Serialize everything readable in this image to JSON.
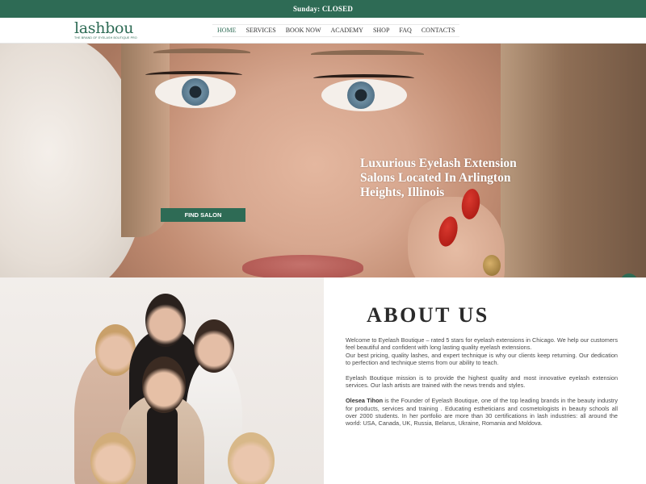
{
  "topbar": {
    "status": "Sunday: CLOSED"
  },
  "header": {
    "logo_word": "lashbou",
    "logo_tagline": "THE BRAND OF EYELASH BOUTIQUE PRO",
    "nav": [
      {
        "label": "HOME"
      },
      {
        "label": "SERVICES"
      },
      {
        "label": "BOOK NOW"
      },
      {
        "label": "ACADEMY"
      },
      {
        "label": "SHOP"
      },
      {
        "label": "FAQ"
      },
      {
        "label": "CONTACTS"
      }
    ]
  },
  "hero": {
    "heading": "Luxurious Eyelash Extension Salons Located In Arlington Heights, Illinois",
    "cta_label": "FIND SALON"
  },
  "about": {
    "title": "ABOUT US",
    "p1a": "Welcome to Eyelash Boutique – rated 5 stars for eyelash extensions in Chicago. We help our customers feel beautiful and confident with long lasting quality eyelash extensions.",
    "p1b": "Our best pricing, quality lashes, and expert technique is why our clients keep returning. Our dedication to perfection and technique stems from our ability to teach.",
    "p2": "Eyelash Boutique mission is to provide the highest quality and most innovative eyelash extension services. Our lash artists are trained with the news trends and styles.",
    "founder_name": "Olesea Tihon",
    "p3": " is the Founder of Eyelash Boutique, one of the top leading brands in the beauty industry for products, services and training . Educating estheticians and cosmetologists in beauty schools all over 2000 students. In her portfolio are more than 30 certifications in lash industries: all around the world: USA, Canada, UK, Russia, Belarus, Ukraine, Romania and Moldova."
  }
}
